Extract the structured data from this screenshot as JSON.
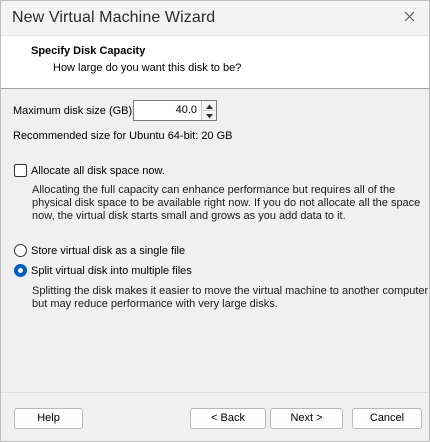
{
  "window": {
    "title": "New Virtual Machine Wizard"
  },
  "header": {
    "title": "Specify Disk Capacity",
    "subtitle": "How large do you want this disk to be?"
  },
  "disk": {
    "max_size_label": "Maximum disk size (GB):",
    "max_size_value": "40.0",
    "recommended_text": "Recommended size for Ubuntu 64-bit: 20 GB"
  },
  "allocate": {
    "label": "Allocate all disk space now.",
    "checked": false,
    "description_line1": "Allocating the full capacity can enhance performance but requires all of the",
    "description_line2": "physical disk space to be available right now. If you do not allocate all the space",
    "description_line3": "now, the virtual disk starts small and grows as you add data to it."
  },
  "storage": {
    "single_file_label": "Store virtual disk as a single file",
    "multiple_files_label": "Split virtual disk into multiple files",
    "selected": "multiple",
    "description_line1": "Splitting the disk makes it easier to move the virtual machine to another computer",
    "description_line2": "but may reduce performance with very large disks."
  },
  "buttons": {
    "help": "Help",
    "back": "< Back",
    "next": "Next >",
    "cancel": "Cancel"
  },
  "icons": {
    "close": "close-icon",
    "spin_up": "chevron-up-icon",
    "spin_down": "chevron-down-icon"
  }
}
